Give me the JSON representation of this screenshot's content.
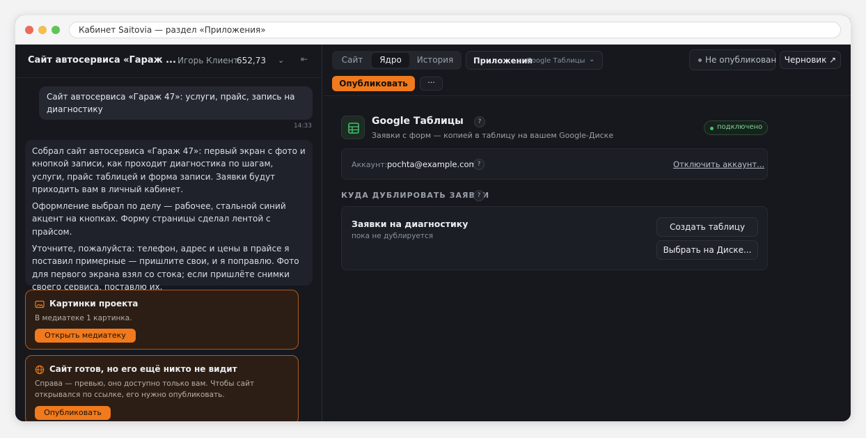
{
  "browser": {
    "url_text": "Кабинет Saitovia — раздел «Приложения»"
  },
  "chat": {
    "site_title": "Сайт автосервиса «Гараж ...",
    "user_name": "Игорь Клиент",
    "balance": "652,73",
    "user_message": "Сайт автосервиса «Гараж 47»: услуги, прайс, запись на диагностику",
    "user_message_time": "14:33",
    "bot_paragraphs": [
      "Собрал сайт автосервиса «Гараж 47»: первый экран с фото и кнопкой записи, как проходит диагностика по шагам, услуги, прайс таблицей и форма записи. Заявки будут приходить вам в личный кабинет.",
      "Оформление выбрал по делу — рабочее, стальной синий акцент на кнопках. Форму страницы сделал лентой с прайсом.",
      "Уточните, пожалуйста: телефон, адрес и цены в прайсе я поставил примерные — пришлите свои, и я поправлю. Фото для первого экрана взял со стока; если пришлёте снимки своего сервиса, поставлю их."
    ],
    "card_media": {
      "title": "Картинки проекта",
      "text": "В медиатеке 1 картинка.",
      "button": "Открыть медиатеку"
    },
    "card_publish": {
      "title": "Сайт готов, но его ещё никто не видит",
      "text": "Справа — превью, оно доступно только вам. Чтобы сайт открывался по ссылке, его нужно опубликовать.",
      "button": "Опубликовать"
    }
  },
  "toolbar": {
    "tabs": [
      "Сайт",
      "Ядро",
      "История"
    ],
    "active_tab": "Ядро",
    "apps_label": "Приложения",
    "apps_selected": "Google Таблицы",
    "status": "Не опубликован",
    "draft_label": "Черновик ↗",
    "publish_label": "Опубликовать",
    "more_label": "···"
  },
  "integration": {
    "name": "Google Таблицы",
    "help": "?",
    "description": "Заявки с форм — копией в таблицу на вашем Google-Диске",
    "status": "подключено",
    "status_color": "#45c46e",
    "account_label": "Аккаунт:",
    "account_email": "pochta@example.com",
    "disconnect_label": "Отключить аккаунт...",
    "section_title": "КУДА ДУБЛИРОВАТЬ ЗАЯВКИ",
    "forms": [
      {
        "name": "Заявки на диагностику",
        "status": "пока не дублируется",
        "create_button": "Создать таблицу",
        "choose_button": "Выбрать на Диске..."
      }
    ]
  },
  "icons": {
    "collapse": "collapse-sidebar-icon",
    "chevron": "chevron-down-icon",
    "sheet": "spreadsheet-icon",
    "image": "image-icon",
    "globe": "globe-icon"
  },
  "colors": {
    "accent": "#f07a1d",
    "background": "#16181d",
    "card_border": "#b35a1c"
  }
}
